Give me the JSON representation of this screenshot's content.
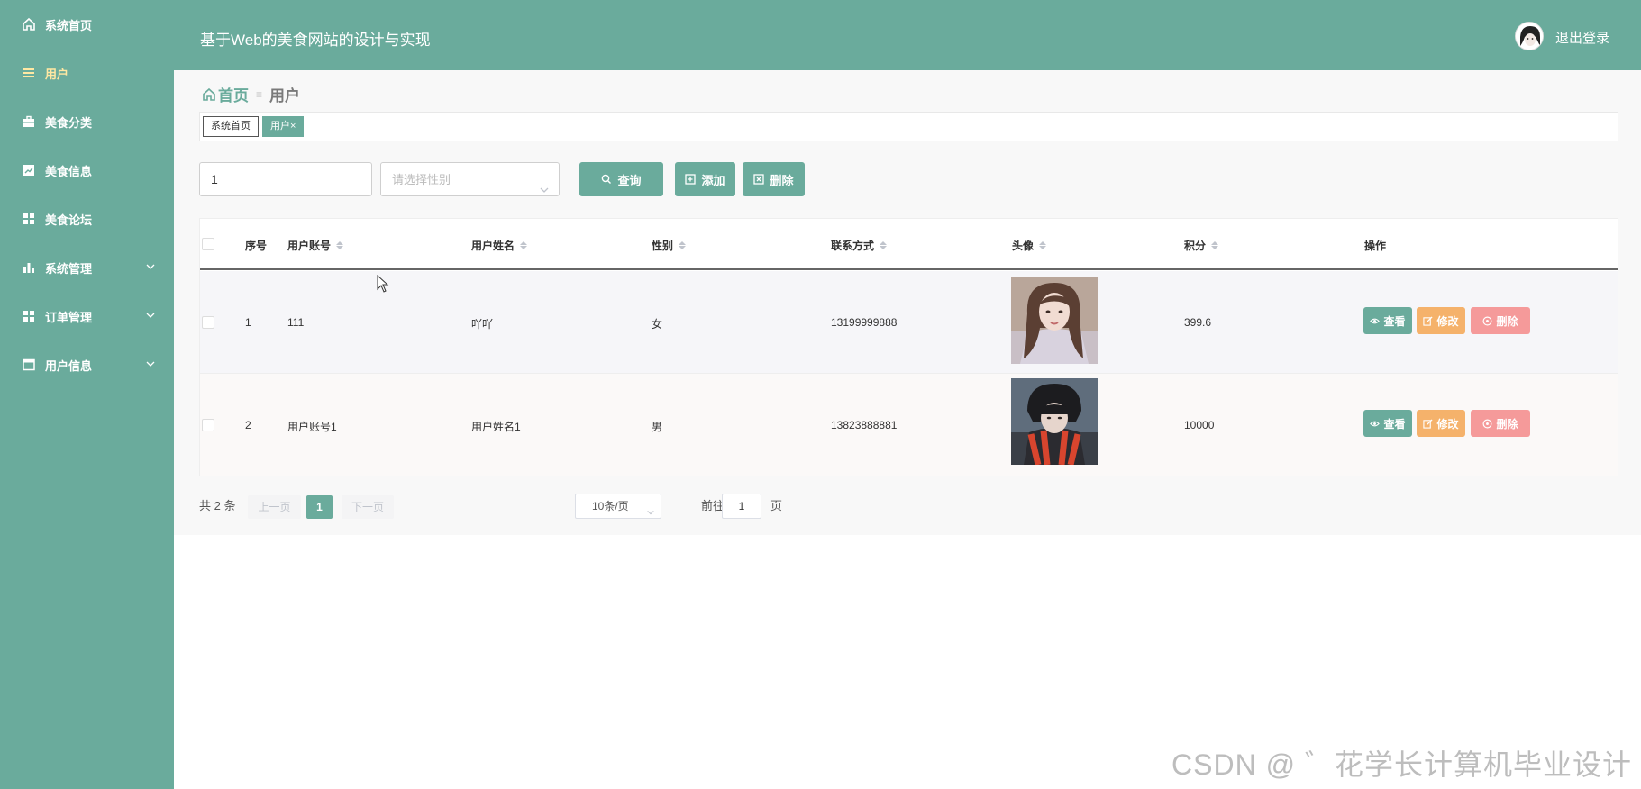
{
  "sidebar": {
    "items": [
      {
        "label": "系统首页",
        "icon": "home-icon"
      },
      {
        "label": "用户",
        "icon": "menu-icon"
      },
      {
        "label": "美食分类",
        "icon": "briefcase-icon"
      },
      {
        "label": "美食信息",
        "icon": "chart-line-icon"
      },
      {
        "label": "美食论坛",
        "icon": "grid-icon"
      },
      {
        "label": "系统管理",
        "icon": "bar-chart-icon"
      },
      {
        "label": "订单管理",
        "icon": "grid-icon"
      },
      {
        "label": "用户信息",
        "icon": "window-icon"
      }
    ]
  },
  "header": {
    "title": "基于Web的美食网站的设计与实现",
    "logout": "退出登录"
  },
  "breadcrumb": {
    "home": "首页",
    "current": "用户"
  },
  "tags": {
    "home": "系统首页",
    "current": "用户",
    "close": "×"
  },
  "search": {
    "account_value": "1",
    "gender_placeholder": "请选择性别",
    "query_label": "查询",
    "add_label": "添加",
    "delete_label": "删除"
  },
  "table": {
    "headers": [
      "序号",
      "用户账号",
      "用户姓名",
      "性别",
      "联系方式",
      "头像",
      "积分",
      "操作"
    ],
    "rows": [
      {
        "index": "1",
        "account": "111",
        "name": "吖吖",
        "gender": "女",
        "phone": "13199999888",
        "points": "399.6"
      },
      {
        "index": "2",
        "account": "用户账号1",
        "name": "用户姓名1",
        "gender": "男",
        "phone": "13823888881",
        "points": "10000"
      }
    ],
    "actions": {
      "view": "查看",
      "edit": "修改",
      "delete": "删除"
    }
  },
  "pagination": {
    "total": "共 2 条",
    "prev": "上一页",
    "page": "1",
    "next": "下一页",
    "page_size": "10条/页",
    "goto_label": "前往",
    "goto_value": "1",
    "goto_unit": "页"
  },
  "watermark": "CSDN @ ゛花学长计算机毕业设计",
  "colors": {
    "primary": "#6aab9c",
    "edit": "#f5b26b",
    "delete": "#f59a9a"
  }
}
